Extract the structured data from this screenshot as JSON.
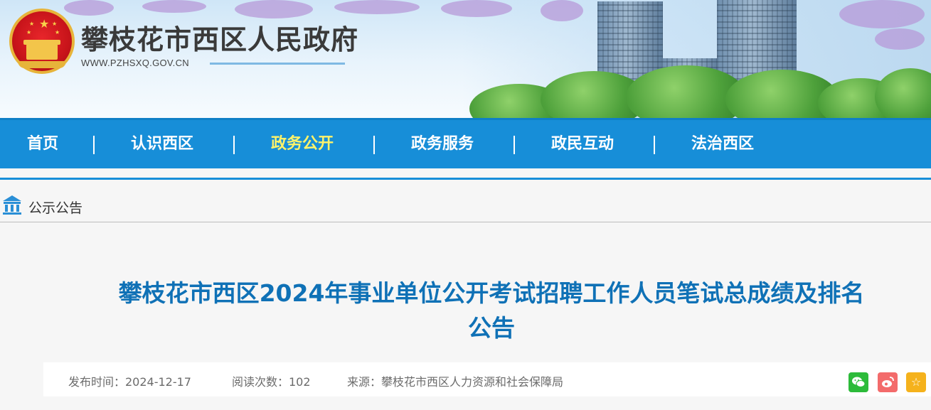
{
  "header": {
    "site_title": "攀枝花市西区人民政府",
    "site_url": "WWW.PZHSXQ.GOV.CN"
  },
  "nav": {
    "items": [
      {
        "label": "首页"
      },
      {
        "label": "认识西区"
      },
      {
        "label": "政务公开",
        "active": true
      },
      {
        "label": "政务服务"
      },
      {
        "label": "政民互动"
      },
      {
        "label": "法治西区"
      }
    ]
  },
  "breadcrumb": {
    "icon": "building-icon",
    "label": "公示公告"
  },
  "article": {
    "title_line1": "攀枝花市西区2024年事业单位公开考试招聘工作人员笔试总成绩及排名",
    "title_line2": "公告",
    "meta": {
      "publish_time": "发布时间：2024-12-17",
      "read_count": "阅读次数：102",
      "source": "来源：攀枝花市西区人力资源和社会保障局"
    },
    "share": [
      {
        "icon": "wechat-icon",
        "color": "#2dbb3a"
      },
      {
        "icon": "weibo-icon",
        "color": "#f36b6b"
      },
      {
        "icon": "favorite-star-icon",
        "color": "#f5b21c"
      }
    ]
  },
  "colors": {
    "nav_bg": "#178ed8",
    "nav_active": "#fff36a",
    "title_blue": "#0f71b6"
  }
}
